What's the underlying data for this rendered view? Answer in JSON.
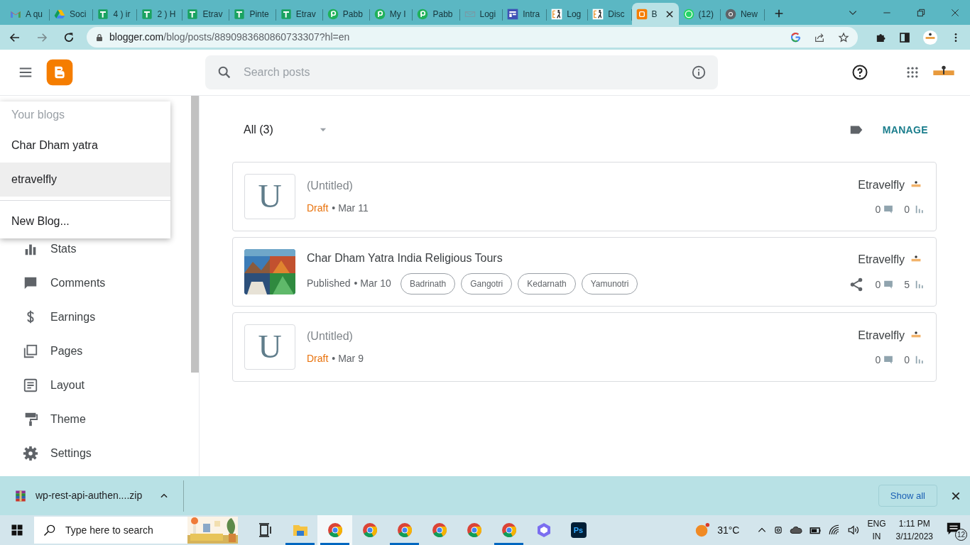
{
  "browser": {
    "tabs": [
      {
        "title": "A qu",
        "kind": "gmail",
        "selected": false
      },
      {
        "title": "Soci",
        "kind": "drive",
        "selected": false
      },
      {
        "title": "4 ) ir",
        "kind": "sheet",
        "selected": false
      },
      {
        "title": "2 ) H",
        "kind": "sheet",
        "selected": false
      },
      {
        "title": "Etrav",
        "kind": "sheet",
        "selected": false
      },
      {
        "title": "Pinte",
        "kind": "sheet",
        "selected": false
      },
      {
        "title": "Etrav",
        "kind": "sheet",
        "selected": false
      },
      {
        "title": "Pabb",
        "kind": "pabbly",
        "selected": false
      },
      {
        "title": "My I",
        "kind": "pabbly",
        "selected": false
      },
      {
        "title": "Pabb",
        "kind": "pabbly",
        "selected": false
      },
      {
        "title": "Logi",
        "kind": "mail",
        "selected": false
      },
      {
        "title": "Intra",
        "kind": "intra",
        "selected": false
      },
      {
        "title": "Log",
        "kind": "etravel",
        "selected": false
      },
      {
        "title": "Disc",
        "kind": "etravel",
        "selected": false
      },
      {
        "title": "B",
        "kind": "blogger",
        "selected": true
      },
      {
        "title": "(12)",
        "kind": "whatsapp",
        "selected": false
      },
      {
        "title": "New",
        "kind": "chrome",
        "selected": false
      }
    ],
    "address": "blogger.com/blog/posts/8890983680860733307?hl=en"
  },
  "search": {
    "placeholder": "Search posts"
  },
  "blog_menu": {
    "heading": "Your blogs",
    "items": [
      {
        "label": "Char Dham yatra",
        "selected": false
      },
      {
        "label": "etravelfly",
        "selected": true
      }
    ],
    "new_blog": "New Blog..."
  },
  "sidebar": {
    "items": [
      {
        "label": "Stats",
        "kind": "stats"
      },
      {
        "label": "Comments",
        "kind": "comments"
      },
      {
        "label": "Earnings",
        "kind": "earnings"
      },
      {
        "label": "Pages",
        "kind": "pages"
      },
      {
        "label": "Layout",
        "kind": "layout"
      },
      {
        "label": "Theme",
        "kind": "theme"
      },
      {
        "label": "Settings",
        "kind": "settings"
      }
    ]
  },
  "filter": "All (3)",
  "manage": "MANAGE",
  "posts": [
    {
      "title": "(Untitled)",
      "untitled": true,
      "thumbnail": {
        "kind": "letter",
        "letter": "U"
      },
      "status": "Draft",
      "draft": true,
      "date": "• Mar 11",
      "author": "Etravelfly",
      "share": false,
      "comments": "0",
      "views": "0"
    },
    {
      "title": "Char Dham Yatra India Religious Tours",
      "untitled": false,
      "status": "Published",
      "draft": false,
      "date": "• Mar 10",
      "labels": [
        "Badrinath",
        "Gangotri",
        "Kedarnath",
        "Yamunotri"
      ],
      "author": "Etravelfly",
      "share": true,
      "comments": "0",
      "views": "5"
    },
    {
      "title": "(Untitled)",
      "untitled": true,
      "thumbnail": {
        "kind": "letter",
        "letter": "U"
      },
      "status": "Draft",
      "draft": true,
      "date": "• Mar 9",
      "author": "Etravelfly",
      "share": false,
      "comments": "0",
      "views": "0"
    }
  ],
  "download": {
    "file": "wp-rest-api-authen....zip",
    "show_all": "Show all"
  },
  "taskbar": {
    "search_placeholder": "Type here to search",
    "apps": [
      {
        "kind": "taskview",
        "running": false,
        "selected": false
      },
      {
        "kind": "explorer",
        "running": true,
        "selected": false
      },
      {
        "kind": "chrome",
        "running": true,
        "selected": true
      },
      {
        "kind": "chrome",
        "running": false,
        "selected": false
      },
      {
        "kind": "chrome",
        "running": true,
        "selected": false
      },
      {
        "kind": "chrome",
        "running": false,
        "selected": false
      },
      {
        "kind": "chrome",
        "running": false,
        "selected": false
      },
      {
        "kind": "chrome",
        "running": true,
        "selected": false
      },
      {
        "kind": "m365",
        "running": false,
        "selected": false
      },
      {
        "kind": "photoshop",
        "label": "Ps",
        "running": false,
        "selected": false
      }
    ],
    "temperature": "31°C",
    "language": "ENG",
    "region": "IN",
    "time": "1:11 PM",
    "date": "3/11/2023",
    "notifications": "12"
  }
}
